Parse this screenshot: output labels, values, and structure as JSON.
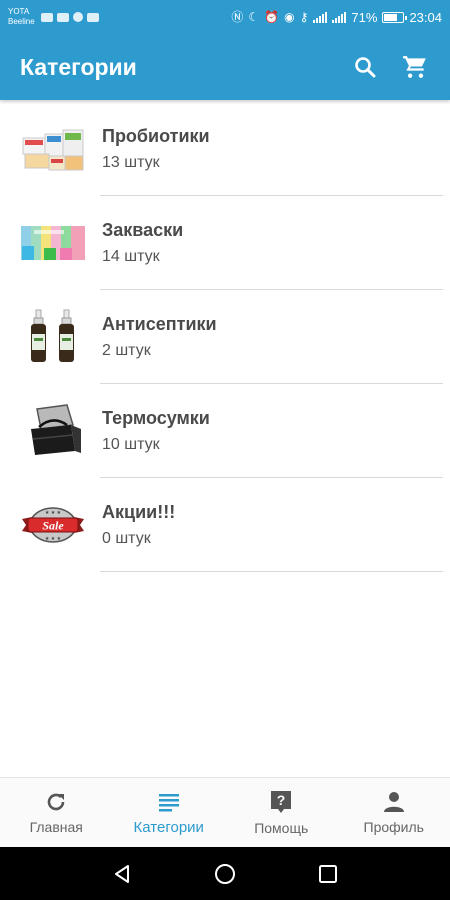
{
  "status_bar": {
    "carrier1": "YOTA",
    "carrier2": "Beeline",
    "battery": "71%",
    "battery_level": 0.71,
    "time": "23:04"
  },
  "app_bar": {
    "title": "Категории",
    "search_icon": "search-icon",
    "cart_icon": "cart-icon"
  },
  "categories": [
    {
      "title": "Пробиотики",
      "count": "13 штук",
      "image": "probiotics-image"
    },
    {
      "title": "Закваски",
      "count": "14 штук",
      "image": "starters-image"
    },
    {
      "title": "Антисептики",
      "count": "2 штук",
      "image": "antiseptics-image"
    },
    {
      "title": "Термосумки",
      "count": "10 штук",
      "image": "thermobag-image"
    },
    {
      "title": "Акции!!!",
      "count": "0 штук",
      "image": "sale-image",
      "badge_text": "Sale"
    }
  ],
  "bottom_nav": {
    "items": [
      {
        "label": "Главная",
        "icon": "refresh-icon",
        "active": false
      },
      {
        "label": "Категории",
        "icon": "list-icon",
        "active": true
      },
      {
        "label": "Помощь",
        "icon": "help-icon",
        "active": false
      },
      {
        "label": "Профиль",
        "icon": "person-icon",
        "active": false
      }
    ]
  },
  "colors": {
    "primary": "#2e9bcf",
    "active_nav": "#2e9bcf",
    "text_title": "#4a4a4a",
    "nav_inactive_icon": "#555555"
  }
}
